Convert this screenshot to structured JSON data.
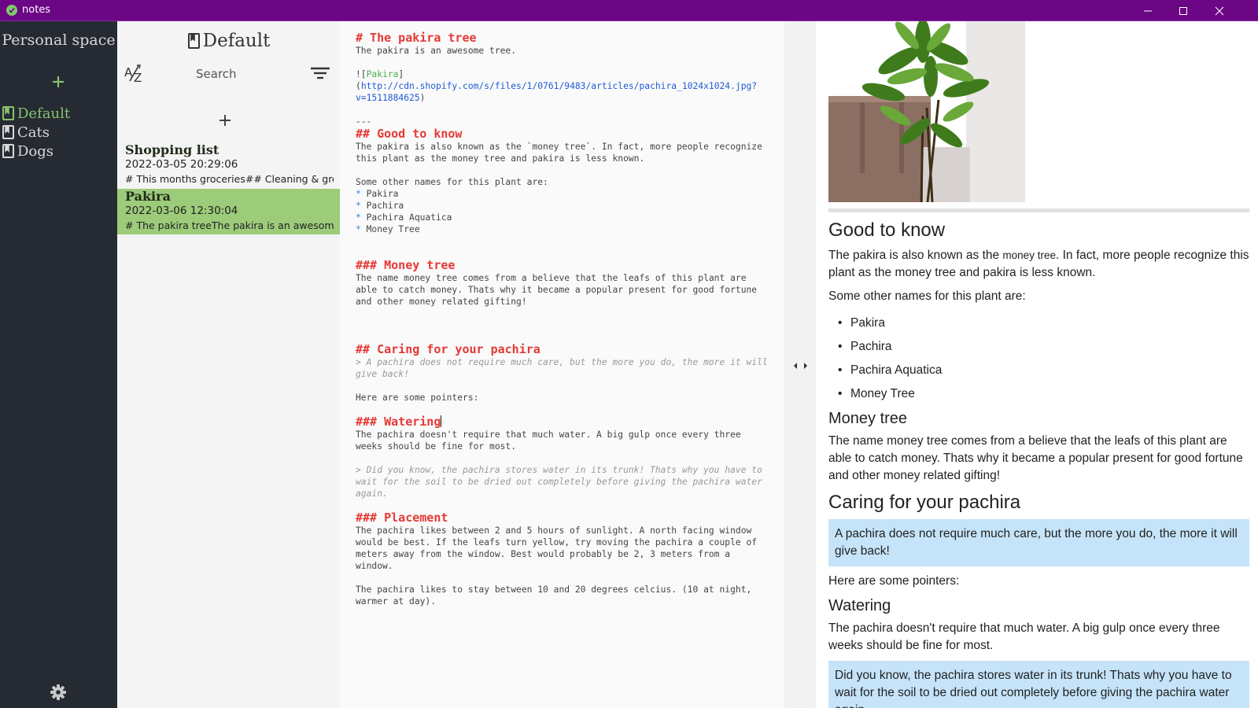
{
  "window": {
    "title": "notes",
    "accent": "#6b0685"
  },
  "sidebar": {
    "space_title": "Personal space",
    "notebooks": [
      {
        "label": "Default"
      },
      {
        "label": "Cats"
      },
      {
        "label": "Dogs"
      }
    ]
  },
  "notelist": {
    "notebook_title": "Default",
    "search_placeholder": "Search",
    "notes": [
      {
        "title": "Shopping list",
        "date": "2022-03-05 20:29:06",
        "preview": "# This months groceries## Cleaning & groceries"
      },
      {
        "title": "Pakira",
        "date": "2022-03-06 12:30:04",
        "preview": "# The pakira treeThe pakira is an awesome tree."
      }
    ]
  },
  "editor": {
    "h1": "# The pakira tree",
    "intro": "The pakira is an awesome tree.",
    "img_prefix": "![",
    "img_alt": "Pakira",
    "img_mid": "](",
    "img_url": "http://cdn.shopify.com/s/files/1/0761/9483/articles/pachira_1024x1024.jpg?v=1511884625",
    "img_suffix": ")",
    "rule": "---",
    "h2_good": "## Good to know",
    "good_p": "The pakira is also known as the `money tree`. In fact, more people recognize this plant as the money tree and pakira is less known.",
    "names_intro": "Some other names for this plant are:",
    "bullet_mark": "*",
    "names": [
      "Pakira",
      "Pachira",
      "Pachira Aquatica",
      "Money Tree"
    ],
    "h3_money": "### Money tree",
    "money_p": "The name money tree comes from a believe that the leafs of this plant are able to catch money. Thats why it became a popular present for good fortune and other money related gifting!",
    "h2_caring": "## Caring for your pachira",
    "caring_quote": "> A pachira does not require much care, but the more you do, the more it will give back!",
    "pointers": "Here are some pointers:",
    "h3_watering": "### Watering",
    "watering_p": "The pachira doesn't require that much water. A big gulp once every three weeks should be fine for most.",
    "watering_quote": "> Did you know, the pachira stores water in its trunk! Thats why you have to wait for the soil to be dried out completely before giving the pachira water again.",
    "h3_placement": "### Placement",
    "placement_p": "The pachira likes between 2 and 5 hours of sunlight. A north facing window would be best. If the leafs turn yellow, try moving the pachira a couple of meters away from the window. Best would probably be 2, 3 meters from a window.",
    "temp_p": "The pachira likes to stay between 10 and 20 degrees celcius. (10 at night, warmer at day)."
  },
  "preview": {
    "image_alt": "Pakira",
    "h2_good": "Good to know",
    "good_p_before": "The pakira is also known as the ",
    "good_code": "money tree",
    "good_p_after": ". In fact, more people recognize this plant as the money tree and pakira is less known.",
    "names_intro": "Some other names for this plant are:",
    "names": [
      "Pakira",
      "Pachira",
      "Pachira Aquatica",
      "Money Tree"
    ],
    "h3_money": "Money tree",
    "money_p": "The name money tree comes from a believe that the leafs of this plant are able to catch money. Thats why it became a popular present for good fortune and other money related gifting!",
    "h2_caring": "Caring for your pachira",
    "caring_quote": "A pachira does not require much care, but the more you do, the more it will give back!",
    "pointers": "Here are some pointers:",
    "h3_watering": "Watering",
    "watering_p": "The pachira doesn't require that much water. A big gulp once every three weeks should be fine for most.",
    "watering_quote": "Did you know, the pachira stores water in its trunk! Thats why you have to wait for the soil to be dried out completely before giving the pachira water again."
  },
  "colors": {
    "titlebar": "#6b0685",
    "sidebar_bg": "#262b33",
    "active_green": "#86c26f",
    "selected_note": "#9ccb7a",
    "heading_red": "#e53935",
    "link_blue": "#1e5bd6",
    "quote_bg": "#c5e4f9"
  },
  "icons": [
    "app-icon",
    "minimize-icon",
    "maximize-icon",
    "close-icon",
    "plus-icon",
    "notebook-icon",
    "sort-az-icon",
    "filter-icon",
    "settings-gear-icon",
    "arrow-left-icon",
    "arrow-right-icon"
  ]
}
